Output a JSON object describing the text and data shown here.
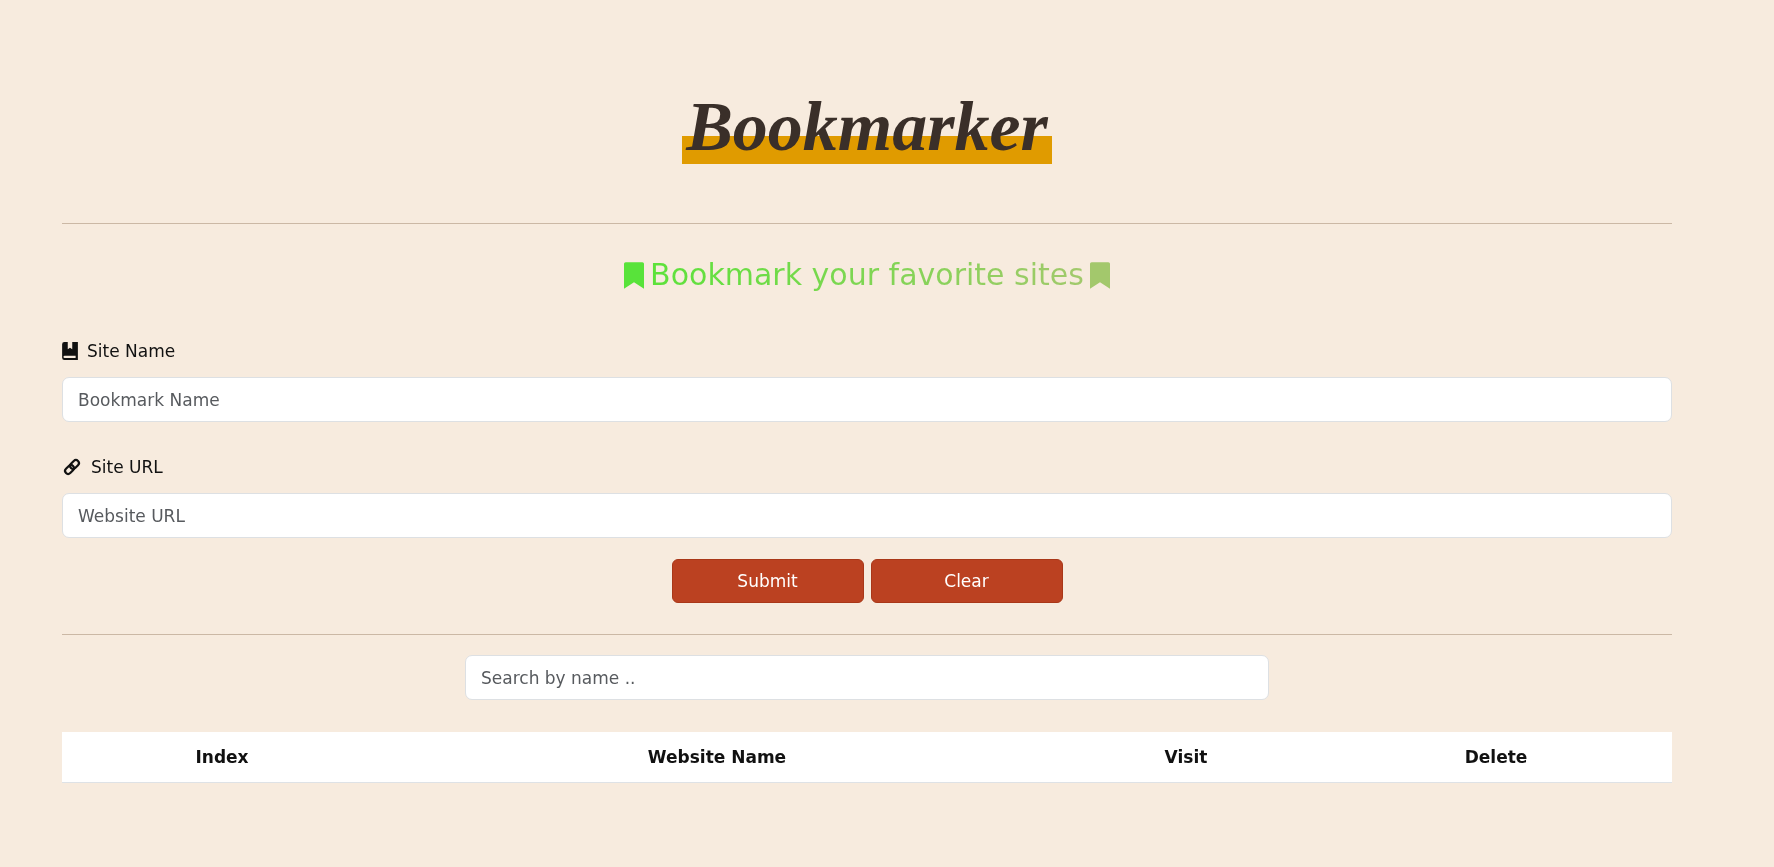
{
  "logo": {
    "text": "Bookmarker"
  },
  "tagline": {
    "text": "Bookmark your favorite sites"
  },
  "form": {
    "fields": [
      {
        "kind": "book",
        "label": "Site Name",
        "placeholder": "Bookmark Name"
      },
      {
        "kind": "link",
        "label": "Site URL",
        "placeholder": "Website URL"
      }
    ],
    "buttons": [
      "Submit",
      "Clear"
    ]
  },
  "search": {
    "placeholder": "Search by name .."
  },
  "table": {
    "columns": [
      "Index",
      "Website Name",
      "Visit",
      "Delete"
    ]
  }
}
